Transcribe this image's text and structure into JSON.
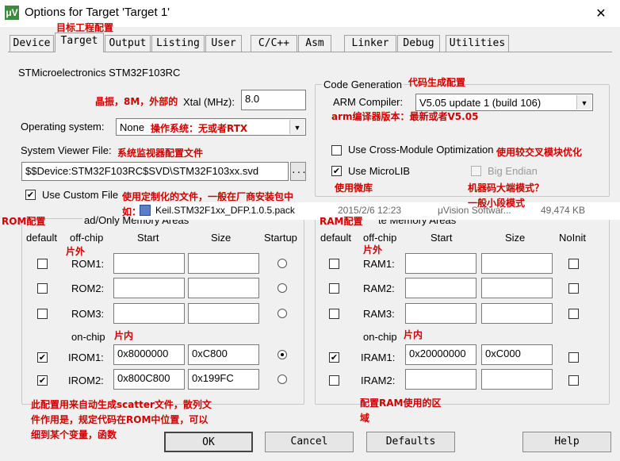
{
  "window": {
    "title": "Options for Target 'Target 1'",
    "app_icon": "μV",
    "close": "✕"
  },
  "tabs": [
    "Device",
    "Target",
    "Output",
    "Listing",
    "User",
    "C/C++",
    "Asm",
    "Linker",
    "Debug",
    "Utilities"
  ],
  "device_name": "STMicroelectronics STM32F103RC",
  "xtal": {
    "label": "Xtal (MHz):",
    "value": "8.0"
  },
  "os": {
    "label": "Operating system:",
    "value": "None"
  },
  "svd": {
    "label": "System Viewer File:",
    "value": "$$Device:STM32F103RC$SVD\\STM32F103xx.svd",
    "browse": "..."
  },
  "custom_file": {
    "label": "Use Custom File",
    "checked": true
  },
  "code_gen": {
    "title": "Code Generation",
    "compiler_label": "ARM Compiler:",
    "compiler_value": "V5.05 update 1 (build 106)",
    "cross_module": {
      "label": "Use Cross-Module Optimization",
      "checked": false
    },
    "microlib": {
      "label": "Use MicroLIB",
      "checked": true
    },
    "big_endian": {
      "label": "Big Endian",
      "checked": false
    }
  },
  "rom": {
    "title_fragment": "ad/Only Memory Areas",
    "headers": {
      "default": "default",
      "offchip": "off-chip",
      "start": "Start",
      "size": "Size",
      "startup": "Startup"
    },
    "onchip_label": "on-chip",
    "rows": [
      {
        "name": "ROM1:",
        "start": "",
        "size": "",
        "default": false,
        "startup": false
      },
      {
        "name": "ROM2:",
        "start": "",
        "size": "",
        "default": false,
        "startup": false
      },
      {
        "name": "ROM3:",
        "start": "",
        "size": "",
        "default": false,
        "startup": false
      },
      {
        "name": "IROM1:",
        "start": "0x8000000",
        "size": "0xC800",
        "default": true,
        "startup": true
      },
      {
        "name": "IROM2:",
        "start": "0x800C800",
        "size": "0x199FC",
        "default": true,
        "startup": false
      }
    ]
  },
  "ram": {
    "title_fragment": "te Memory Areas",
    "headers": {
      "default": "default",
      "offchip": "off-chip",
      "start": "Start",
      "size": "Size",
      "noinit": "NoInit"
    },
    "onchip_label": "on-chip",
    "rows": [
      {
        "name": "RAM1:",
        "start": "",
        "size": "",
        "default": false,
        "noinit": false
      },
      {
        "name": "RAM2:",
        "start": "",
        "size": "",
        "default": false,
        "noinit": false
      },
      {
        "name": "RAM3:",
        "start": "",
        "size": "",
        "default": false,
        "noinit": false
      },
      {
        "name": "IRAM1:",
        "start": "0x20000000",
        "size": "0xC000",
        "default": true,
        "noinit": false
      },
      {
        "name": "IRAM2:",
        "start": "",
        "size": "",
        "default": false,
        "noinit": false
      }
    ]
  },
  "overlay_file": {
    "name": "Keil.STM32F1xx_DFP.1.0.5.pack",
    "date": "2015/2/6 12:23",
    "type": "μVision Softwar...",
    "size": "49,474 KB"
  },
  "annotations": {
    "target": "目标工程配置",
    "xtal": "晶振，8M，外部的",
    "os": "操作系统：无或者RTX",
    "svd": "系统监视器配置文件",
    "custom_1": "使用定制化的文件，一般在厂商安装包中",
    "custom_2": "如：",
    "code_gen": "代码生成配置",
    "compiler": "arm编译器版本：最新或者V5.05",
    "cross": "使用较交叉模块优化",
    "microlib": "使用微库",
    "endian_1": "机器码大端模式？",
    "endian_2": "一般小段模式",
    "rom": "ROM配置",
    "ram": "RAM配置",
    "rom_offchip": "片外",
    "rom_onchip": "片内",
    "ram_offchip": "片外",
    "ram_onchip": "片内",
    "scatter_1": "此配置用来自动生成scatter文件，散列文",
    "scatter_2": "件作用是，规定代码在ROM中位置，可以",
    "scatter_3": "细到某个变量，函数",
    "ram_use_1": "配置RAM使用的区",
    "ram_use_2": "域"
  },
  "buttons": {
    "ok": "OK",
    "cancel": "Cancel",
    "defaults": "Defaults",
    "help": "Help"
  }
}
